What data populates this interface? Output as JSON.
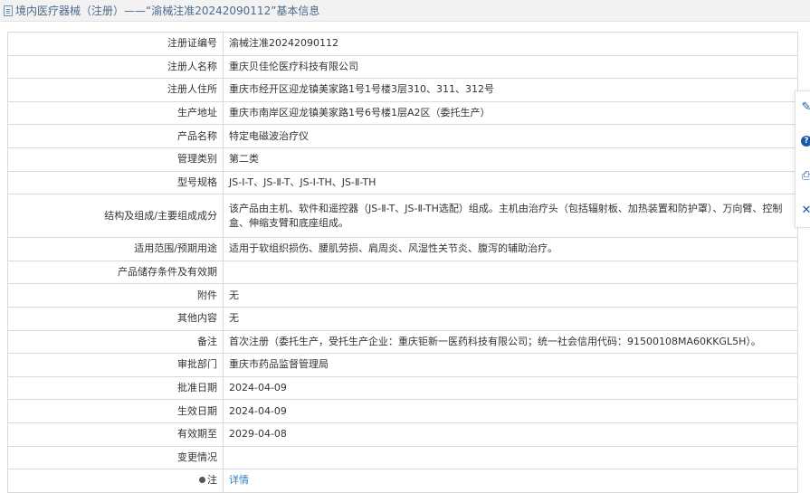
{
  "header": {
    "breadcrumb": "境内医疗器械（注册）——“渝械注准20242090112”基本信息"
  },
  "rows": [
    {
      "label": "注册证编号",
      "value": "渝械注准20242090112"
    },
    {
      "label": "注册人名称",
      "value": "重庆贝佳伦医疗科技有限公司"
    },
    {
      "label": "注册人住所",
      "value": "重庆市经开区迎龙镇美家路1号1号楼3层310、311、312号"
    },
    {
      "label": "生产地址",
      "value": "重庆市南岸区迎龙镇美家路1号6号楼1层A2区（委托生产）"
    },
    {
      "label": "产品名称",
      "value": "特定电磁波治疗仪"
    },
    {
      "label": "管理类别",
      "value": "第二类"
    },
    {
      "label": "型号规格",
      "value": "JS-Ⅰ-T、JS-Ⅱ-T、JS-Ⅰ-TH、JS-Ⅱ-TH"
    },
    {
      "label": "结构及组成/主要组成成分",
      "value": "该产品由主机、软件和遥控器（JS-Ⅱ-T、JS-Ⅱ-TH选配）组成。主机由治疗头（包括辐射板、加热装置和防护罩）、万向臂、控制盒、伸缩支臂和底座组成。"
    },
    {
      "label": "适用范围/预期用途",
      "value": "适用于软组织损伤、腰肌劳损、肩周炎、风湿性关节炎、腹泻的辅助治疗。"
    },
    {
      "label": "产品储存条件及有效期",
      "value": ""
    },
    {
      "label": "附件",
      "value": "无"
    },
    {
      "label": "其他内容",
      "value": "无"
    },
    {
      "label": "备注",
      "value": "首次注册（委托生产，受托生产企业：重庆钜新一医药科技有限公司；统一社会信用代码：91500108MA60KKGL5H）。"
    },
    {
      "label": "审批部门",
      "value": "重庆市药品监督管理局"
    },
    {
      "label": "批准日期",
      "value": "2024-04-09"
    },
    {
      "label": "生效日期",
      "value": "2024-04-09"
    },
    {
      "label": "有效期至",
      "value": "2029-04-08"
    },
    {
      "label": "变更情况",
      "value": ""
    },
    {
      "label": "注",
      "value": "详情"
    }
  ],
  "icons": {
    "header": "document-icon",
    "note": "lightbulb-icon",
    "side": [
      "edit-icon",
      "help-icon",
      "print-icon",
      "close-icon"
    ]
  },
  "colors": {
    "header_text": "#4a6a8e",
    "link": "#2f7fc8",
    "side_icon": "#1a5aa8"
  }
}
